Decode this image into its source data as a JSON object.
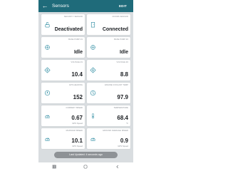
{
  "header": {
    "back_glyph": "←",
    "title": "Sensors",
    "edit_label": "EDIT"
  },
  "cards": [
    {
      "label": "SECURITY SENSOR",
      "value": "Deactivated",
      "icon": "lock-open-icon"
    },
    {
      "label": "DOORS SENSOR",
      "value": "Connected",
      "icon": "door-icon"
    },
    {
      "label": "BASE PUMP #1",
      "value": "Idle",
      "icon": "pump-icon"
    },
    {
      "label": "BASE PUMP #2",
      "value": "Idle",
      "icon": "pump-icon"
    },
    {
      "label": "VOLTAGE #1",
      "value": "10.4",
      "icon": "voltage-icon"
    },
    {
      "label": "VOLTAGE #2",
      "value": "8.8",
      "icon": "voltage-icon"
    },
    {
      "label": "GPS HEADING",
      "value": "152",
      "icon": "heading-icon"
    },
    {
      "label": "ENGINE COOLANT TEMP",
      "value": "97.9",
      "icon": "temperature-icon"
    },
    {
      "label": "CURRENT SPEED",
      "value": "0.67",
      "unit": "GPS Speed",
      "icon": "speed-icon"
    },
    {
      "label": "TEMPERATURE",
      "value": "68.4",
      "unit": "°F",
      "icon": "thermometer-icon"
    },
    {
      "label": "MAXIMUM SPEED",
      "value": "10.1",
      "unit": "GPS Speed",
      "icon": "speed-icon"
    },
    {
      "label": "GROUND AVERAGE SPEED",
      "value": "0.9",
      "unit": "GPS Speed",
      "icon": "speed-icon"
    }
  ],
  "toast": {
    "text": "Last Updated: 4 seconds ago"
  },
  "colors": {
    "header_bg": "#1f6b7a",
    "icon_accent": "#2a8aa0",
    "background": "#d9dde0"
  }
}
